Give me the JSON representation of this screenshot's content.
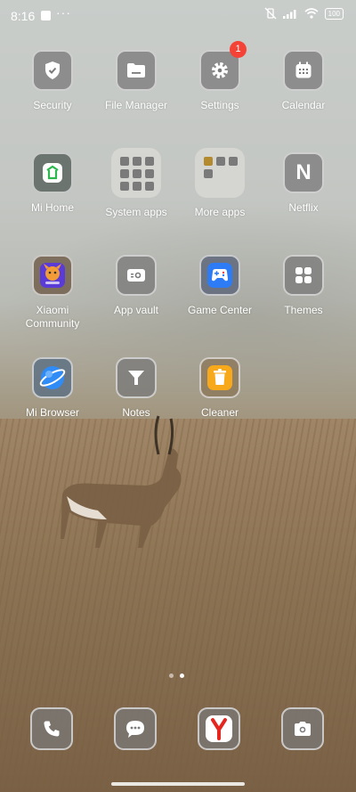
{
  "status_bar": {
    "time": "8:16",
    "dots": "···",
    "battery": "100"
  },
  "home": {
    "rows": [
      [
        {
          "label": "Security",
          "icon": "shield-check-icon",
          "badge": ""
        },
        {
          "label": "File Manager",
          "icon": "folder-icon",
          "badge": ""
        },
        {
          "label": "Settings",
          "icon": "gear-icon",
          "badge": "1"
        },
        {
          "label": "Calendar",
          "icon": "calendar-icon",
          "badge": ""
        }
      ],
      [
        {
          "label": "Mi Home",
          "icon": "mi-home-icon"
        },
        {
          "label": "System apps",
          "icon": "folder-grid-icon"
        },
        {
          "label": "More apps",
          "icon": "folder-grid-icon"
        },
        {
          "label": "Netflix",
          "icon": "netflix-icon"
        }
      ],
      [
        {
          "label": "Xiaomi Community",
          "icon": "xiaomi-community-icon"
        },
        {
          "label": "App vault",
          "icon": "app-vault-icon"
        },
        {
          "label": "Game Center",
          "icon": "gamepad-icon"
        },
        {
          "label": "Themes",
          "icon": "themes-icon"
        }
      ],
      [
        {
          "label": "Mi Browser",
          "icon": "globe-icon"
        },
        {
          "label": "Notes",
          "icon": "notes-icon"
        },
        {
          "label": "Cleaner",
          "icon": "trash-icon"
        }
      ]
    ],
    "page_indicator": {
      "pages": 2,
      "current": 2
    }
  },
  "dock": [
    {
      "name": "phone",
      "icon": "phone-icon"
    },
    {
      "name": "messages",
      "icon": "message-icon"
    },
    {
      "name": "yandex-browser",
      "icon": "yandex-icon"
    },
    {
      "name": "camera",
      "icon": "camera-icon"
    }
  ],
  "colors": {
    "badge": "#f44336",
    "icon_bg": "#7a7a7a",
    "yandex_red": "#e52620"
  }
}
